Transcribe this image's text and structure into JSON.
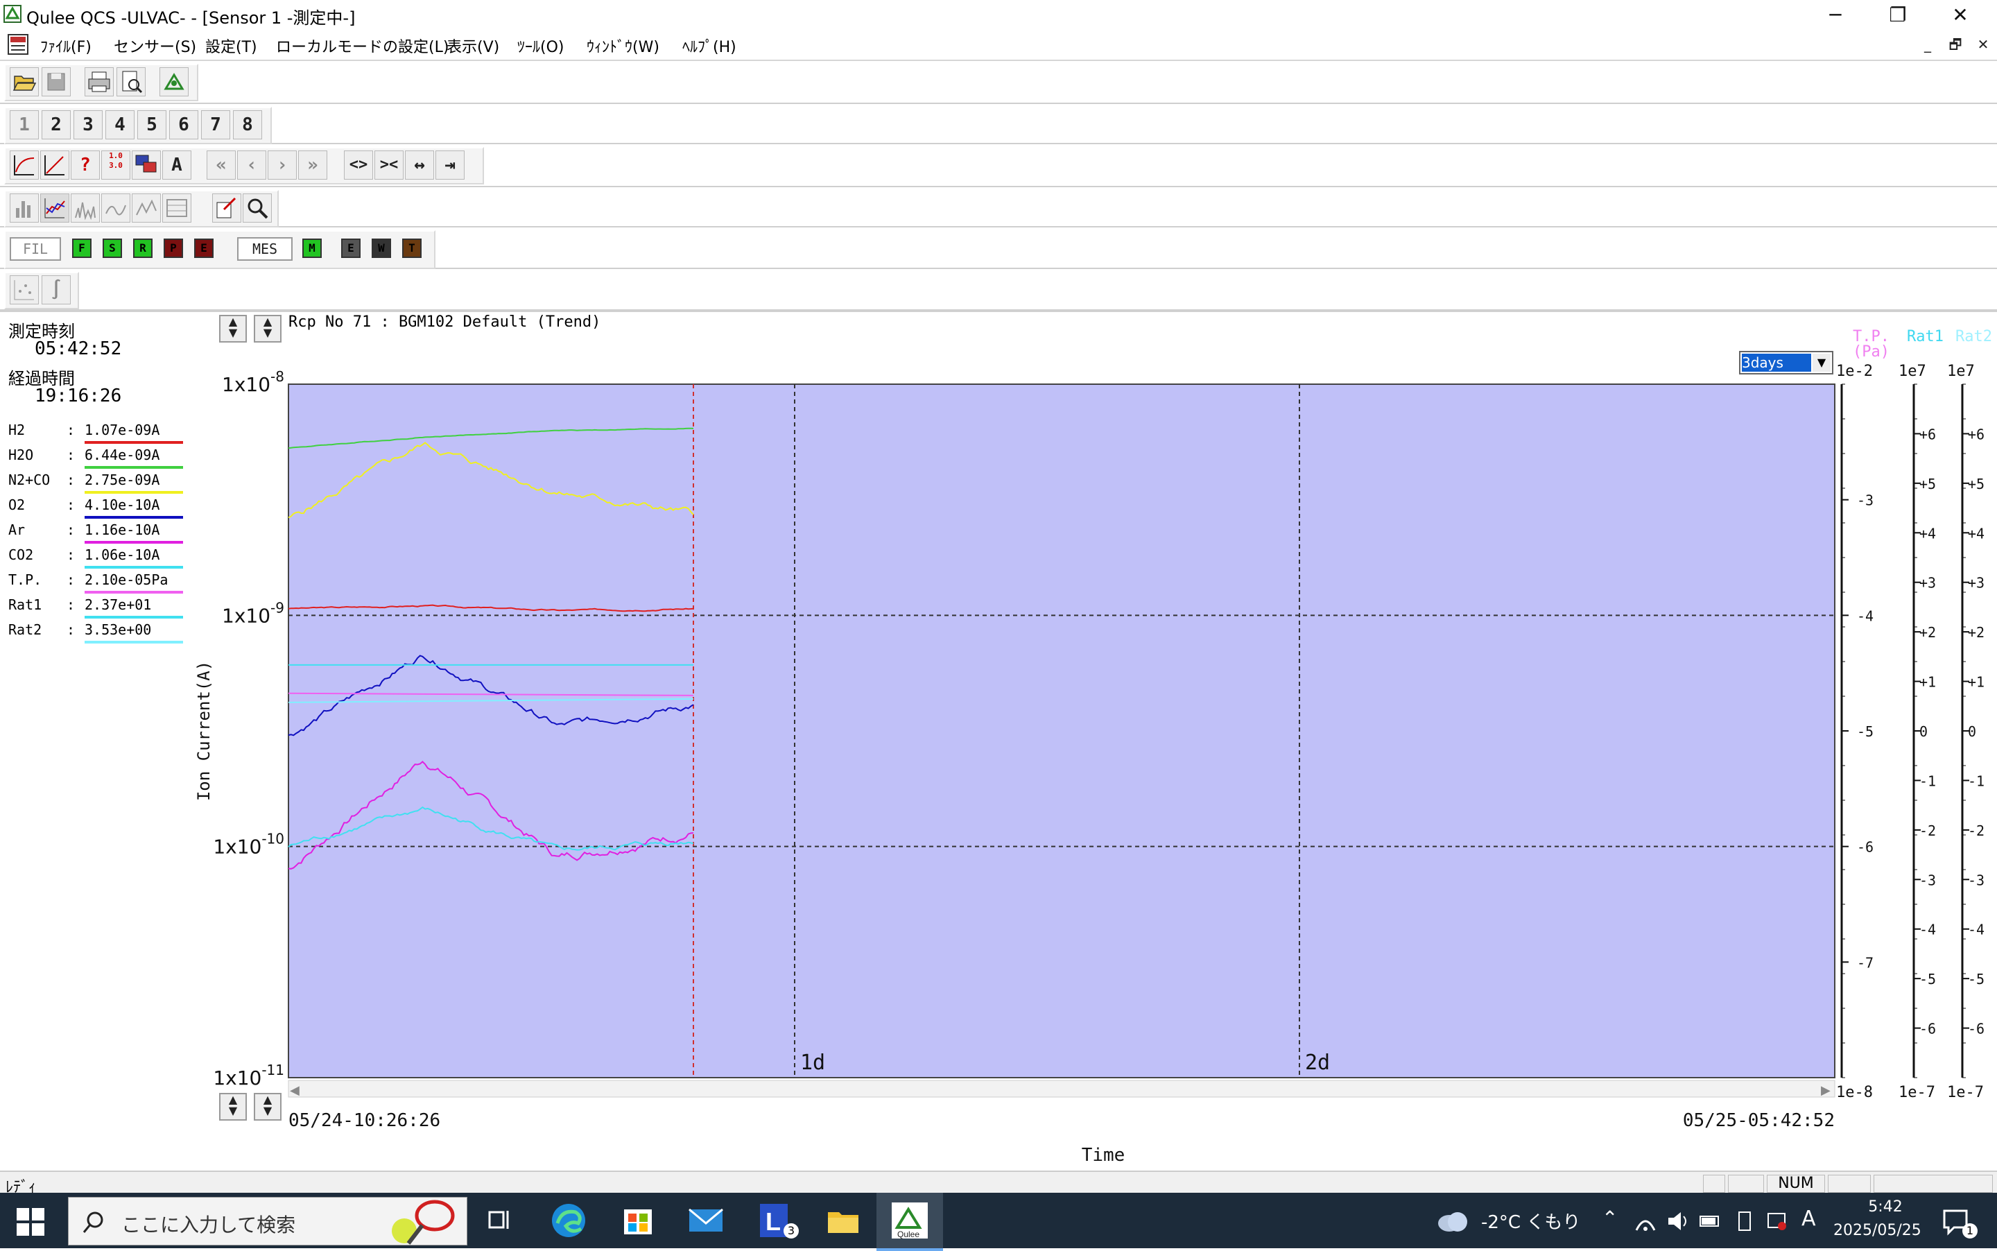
{
  "window": {
    "title": "Qulee QCS  -ULVAC-   - [Sensor 1 -測定中-]",
    "minimize": "─",
    "restore": "❐",
    "close": "✕"
  },
  "menu": {
    "items": [
      "ﾌｧｲﾙ(F)",
      "センサー(S)",
      "設定(T)",
      "ローカルモードの設定(L)",
      "表示(V)",
      "ﾂｰﾙ(O)",
      "ｳｨﾝﾄﾞｳ(W)",
      "ﾍﾙﾌﾟ(H)"
    ],
    "mdi_min": "_",
    "mdi_restore": "🗗",
    "mdi_close": "✕"
  },
  "toolbar_channels": [
    "1",
    "2",
    "3",
    "4",
    "5",
    "6",
    "7",
    "8"
  ],
  "toolbar_lamps": {
    "fil": "FIL",
    "mes": "MES",
    "lamps": [
      {
        "label": "F",
        "color": "#22c322"
      },
      {
        "label": "S",
        "color": "#22c322"
      },
      {
        "label": "R",
        "color": "#22c322"
      },
      {
        "label": "P",
        "color": "#7a1010"
      },
      {
        "label": "E",
        "color": "#7a1010"
      },
      {
        "label": "M",
        "color": "#22c322"
      },
      {
        "label": "E",
        "color": "#555555"
      },
      {
        "label": "W",
        "color": "#333333"
      },
      {
        "label": "T",
        "color": "#6a3a10"
      }
    ]
  },
  "left_panel": {
    "meas_time_label": "測定時刻",
    "meas_time": "05:42:52",
    "elapsed_label": "経過時間",
    "elapsed_time": "19:16:26",
    "channels": [
      {
        "name": "H2",
        "value": "1.07e-09A",
        "color": "#e02020"
      },
      {
        "name": "H2O",
        "value": "6.44e-09A",
        "color": "#40d040"
      },
      {
        "name": "N2+CO",
        "value": "2.75e-09A",
        "color": "#f0f020"
      },
      {
        "name": "O2",
        "value": "4.10e-10A",
        "color": "#1010c0"
      },
      {
        "name": "Ar",
        "value": "1.16e-10A",
        "color": "#e020e0"
      },
      {
        "name": "CO2",
        "value": "1.06e-10A",
        "color": "#40e0f0"
      },
      {
        "name": "T.P.",
        "value": "2.10e-05Pa",
        "color": "#f060f0"
      },
      {
        "name": "Rat1",
        "value": "2.37e+01",
        "color": "#40e0f0"
      },
      {
        "name": "Rat2",
        "value": "3.53e+00",
        "color": "#80f0ff"
      }
    ]
  },
  "graph": {
    "recipe": "Rcp No 71 : BGM102 Default (Trend)",
    "range_select": "3days",
    "y_label": "Ion Current(A)",
    "x_label": "Time",
    "x_start": "05/24-10:26:26",
    "x_end": "05/25-05:42:52",
    "day_marks": [
      "1d",
      "2d"
    ],
    "y_ticks": [
      {
        "base": "1x10",
        "exp": "-8"
      },
      {
        "base": "1x10",
        "exp": "-9"
      },
      {
        "base": "1x10",
        "exp": "-10"
      },
      {
        "base": "1x10",
        "exp": "-11"
      }
    ],
    "right_axes": {
      "tp": {
        "title1": "T.P.",
        "title2": "(Pa)",
        "top": "1e-2",
        "bottom": "1e-8",
        "ticks": [
          "-3",
          "-4",
          "-5",
          "-6",
          "-7"
        ],
        "color": "#f080f0"
      },
      "rat1": {
        "title": "Rat1",
        "top": "1e7",
        "bottom": "1e-7",
        "ticks": [
          "+6",
          "+5",
          "+4",
          "+3",
          "+2",
          "+1",
          "0",
          "-1",
          "-2",
          "-3",
          "-4",
          "-5",
          "-6"
        ],
        "color": "#40d8f0"
      },
      "rat2": {
        "title": "Rat2",
        "top": "1e7",
        "bottom": "1e-7",
        "ticks": [
          "+6",
          "+5",
          "+4",
          "+3",
          "+2",
          "+1",
          "0",
          "-1",
          "-2",
          "-3",
          "-4",
          "-5",
          "-6"
        ],
        "color": "#a0f0ff"
      }
    },
    "plot_bg": "#c0c0f8"
  },
  "statusbar": {
    "text": "ﾚﾃﾞｨ",
    "num": "NUM"
  },
  "taskbar": {
    "search_placeholder": "ここに入力して検索",
    "weather": "-2°C くもり",
    "time": "5:42",
    "date": "2025/05/25",
    "ime": "A",
    "badge_l": "3",
    "notif_count": "1"
  },
  "chart_data": {
    "type": "line",
    "ylabel": "Ion Current(A)",
    "xlabel": "Time",
    "yscale": "log",
    "ylim": [
      1e-11,
      1e-08
    ],
    "x_range": [
      "05/24-10:26:26",
      "05/25-05:42:52"
    ],
    "series": [
      {
        "name": "H2",
        "values": [
          1.07e-09,
          1.1e-09,
          1.05e-09,
          1.07e-09
        ]
      },
      {
        "name": "H2O",
        "values": [
          5.3e-09,
          5.9e-09,
          6.3e-09,
          6.44e-09
        ]
      },
      {
        "name": "N2+CO",
        "values": [
          2.6e-09,
          5.5e-09,
          3.4e-09,
          2.75e-09
        ]
      },
      {
        "name": "O2",
        "values": [
          3e-10,
          6.8e-10,
          3.3e-10,
          4.1e-10
        ]
      },
      {
        "name": "Ar",
        "values": [
          8e-11,
          2.4e-10,
          9e-11,
          1.16e-10
        ]
      },
      {
        "name": "CO2",
        "values": [
          1e-10,
          1.45e-10,
          9.5e-11,
          1.06e-10
        ]
      }
    ]
  }
}
